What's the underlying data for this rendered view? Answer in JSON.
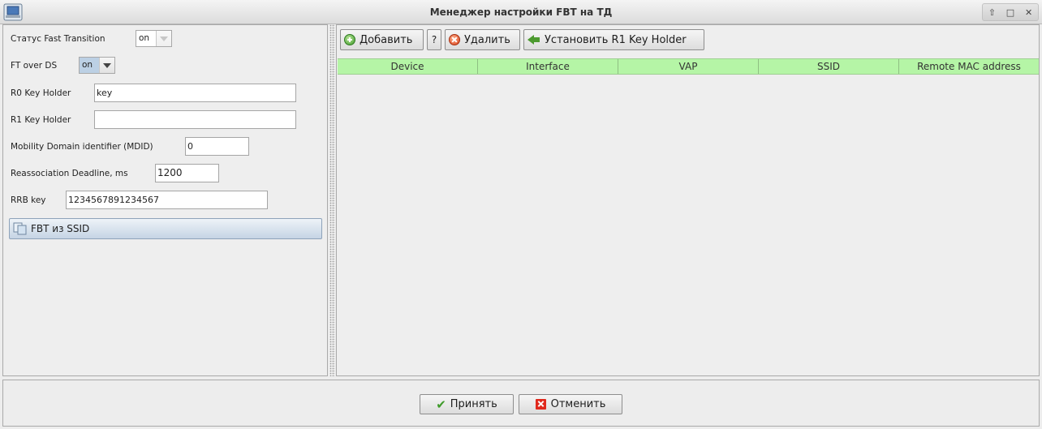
{
  "window": {
    "title": "Менеджер настройки FBT на ТД",
    "controls": [
      "up-arrow-icon",
      "maximize-icon",
      "close-icon"
    ]
  },
  "form": {
    "fast_transition_label": "Статус Fast Transition",
    "fast_transition_value": "on",
    "ft_over_ds_label": "FT over DS",
    "ft_over_ds_value": "on",
    "r0_label": "R0 Key Holder",
    "r0_value": "key",
    "r1_label": "R1 Key Holder",
    "r1_value": "",
    "mdid_label": "Mobility Domain identifier (MDID)",
    "mdid_value": "0",
    "deadline_label": "Reassociation Deadline, ms",
    "deadline_value": "1200",
    "rrb_label": "RRB key",
    "rrb_value": "1234567891234567",
    "fbt_ssid_button": "FBT из SSID"
  },
  "toolbar": {
    "add_label": "Добавить",
    "help_label": "?",
    "delete_label": "Удалить",
    "set_r1_label": "Установить R1 Key Holder"
  },
  "table": {
    "columns": [
      "Device",
      "Interface",
      "VAP",
      "SSID",
      "Remote MAC address"
    ],
    "rows": []
  },
  "footer": {
    "accept_label": "Принять",
    "cancel_label": "Отменить"
  },
  "colors": {
    "table_header": "#b5f5a6",
    "accept_icon": "#3f9b2a",
    "cancel_icon": "#e0281c"
  }
}
